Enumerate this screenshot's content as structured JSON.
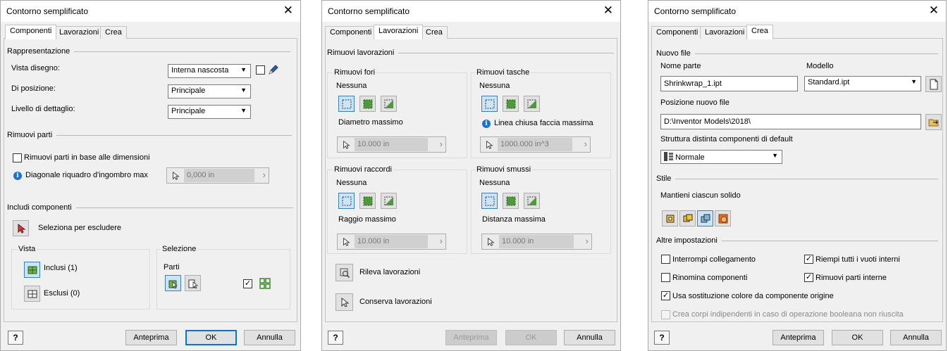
{
  "dialog1": {
    "title": "Contorno semplificato",
    "tabs": [
      "Componenti",
      "Lavorazioni",
      "Crea"
    ],
    "rappresentazione": "Rappresentazione",
    "vista_disegno_label": "Vista disegno:",
    "vista_disegno_value": "Interna nascosta",
    "di_posizione_label": "Di posizione:",
    "di_posizione_value": "Principale",
    "livello_label": "Livello di dettaglio:",
    "livello_value": "Principale",
    "rimuovi_parti": "Rimuovi parti",
    "rimuovi_dim_label": "Rimuovi parti in base alle dimensioni",
    "diagonale_label": "Diagonale riquadro d'ingombro max",
    "diagonale_value": "0,000 in",
    "includi": "Includi componenti",
    "seleziona_label": "Seleziona per escludere",
    "vista": "Vista",
    "inclusi": "Inclusi (1)",
    "esclusi": "Esclusi (0)",
    "selezione": "Selezione",
    "parti": "Parti",
    "help": "?",
    "anteprima": "Anteprima",
    "ok": "OK",
    "annulla": "Annulla"
  },
  "dialog2": {
    "title": "Contorno semplificato",
    "tabs": [
      "Componenti",
      "Lavorazioni",
      "Crea"
    ],
    "rimuovi_lavorazioni": "Rimuovi lavorazioni",
    "groups": [
      {
        "title": "Rimuovi fori",
        "nessuna": "Nessuna",
        "param": "Diametro massimo",
        "value": "10.000 in"
      },
      {
        "title": "Rimuovi tasche",
        "nessuna": "Nessuna",
        "param": "Linea chiusa faccia massima",
        "value": "1000.000 in^3"
      },
      {
        "title": "Rimuovi raccordi",
        "nessuna": "Nessuna",
        "param": "Raggio massimo",
        "value": "10.000 in"
      },
      {
        "title": "Rimuovi smussi",
        "nessuna": "Nessuna",
        "param": "Distanza massima",
        "value": "10.000 in"
      }
    ],
    "rileva": "Rileva lavorazioni",
    "conserva": "Conserva lavorazioni",
    "help": "?",
    "anteprima": "Anteprima",
    "ok": "OK",
    "annulla": "Annulla"
  },
  "dialog3": {
    "title": "Contorno semplificato",
    "tabs": [
      "Componenti",
      "Lavorazioni",
      "Crea"
    ],
    "nuovo_file": "Nuovo file",
    "nome_parte_label": "Nome parte",
    "nome_parte_value": "Shrinkwrap_1.ipt",
    "modello_label": "Modello",
    "modello_value": "Standard.ipt",
    "posizione_label": "Posizione nuovo file",
    "posizione_value": "D:\\Inventor Models\\2018\\",
    "struttura_label": "Struttura distinta componenti di default",
    "struttura_value": "Normale",
    "stile": "Stile",
    "mantieni": "Mantieni ciascun solido",
    "altre": "Altre impostazioni",
    "interrompi": "Interrompi collegamento",
    "riempi": "Riempi tutti i vuoti interni",
    "rinomina": "Rinomina componenti",
    "rimuovi_interne": "Rimuovi parti interne",
    "usa_colore": "Usa sostituzione colore da componente origine",
    "crea_corpi": "Crea corpi indipendenti in caso di operazione booleana non riuscita",
    "help": "?",
    "anteprima": "Anteprima",
    "ok": "OK",
    "annulla": "Annulla"
  }
}
